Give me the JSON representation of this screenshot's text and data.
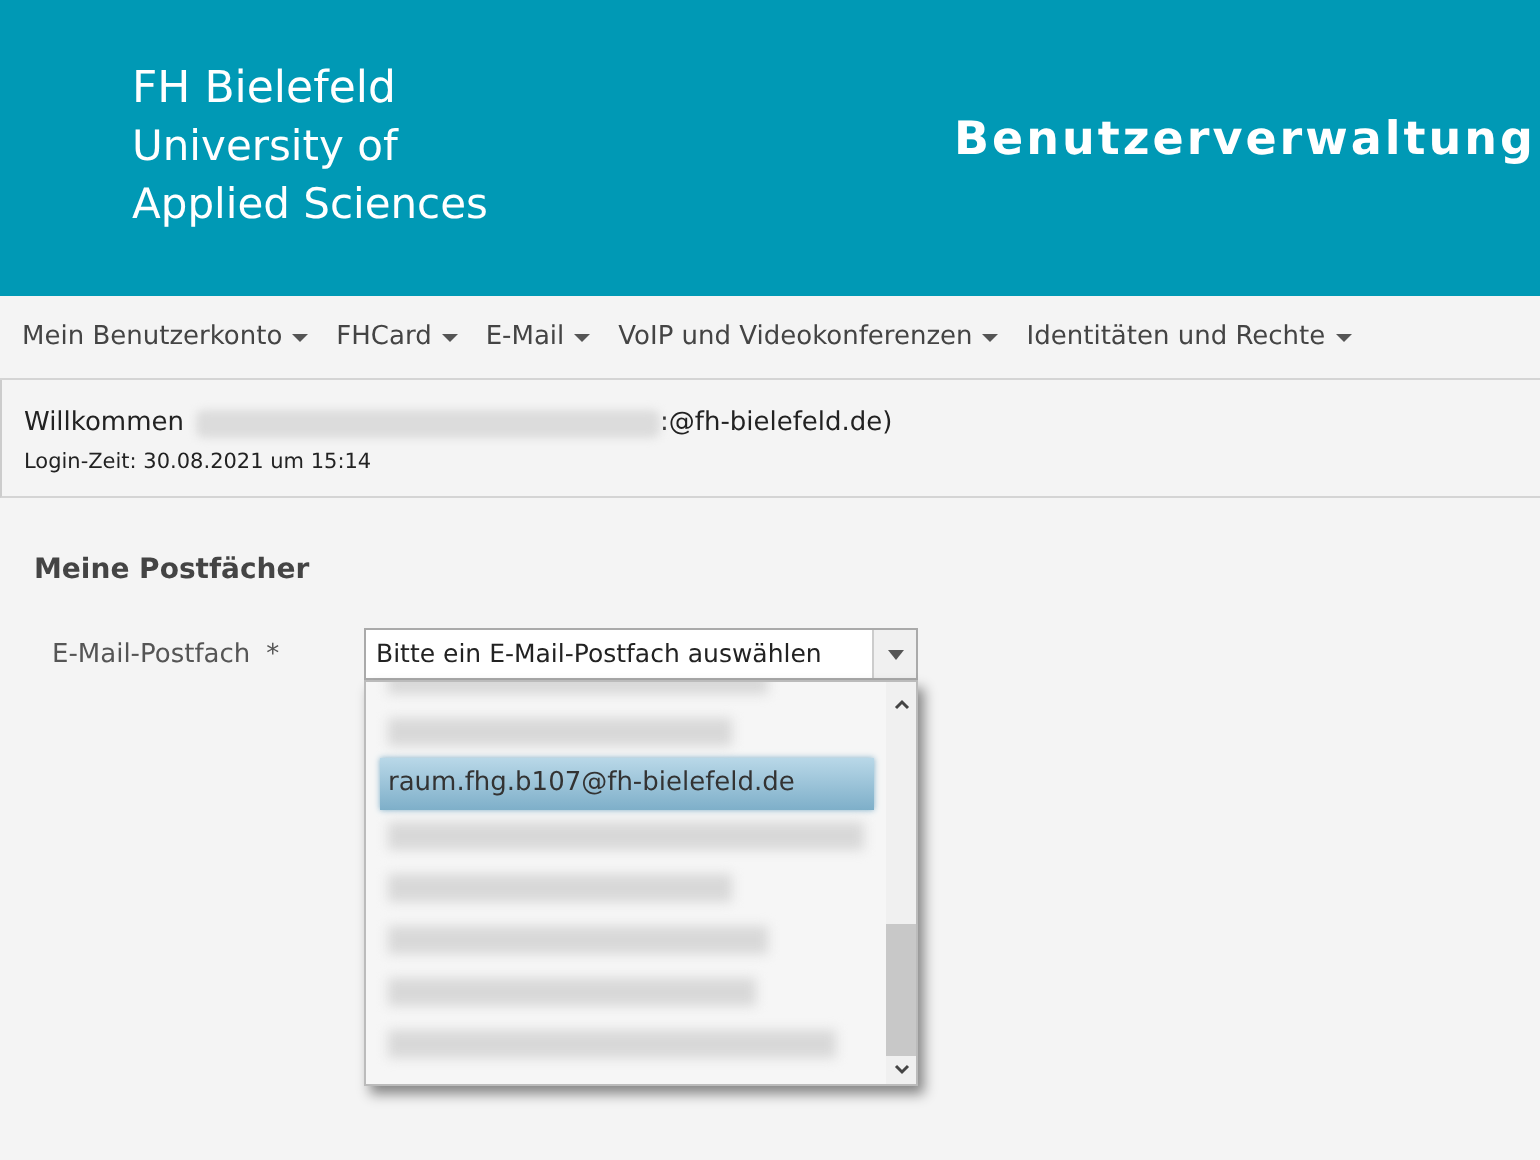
{
  "header": {
    "logo_lines": [
      "FH Bielefeld",
      "University of",
      "Applied Sciences"
    ],
    "title": "Benutzerverwaltung"
  },
  "nav": [
    "Mein Benutzerkonto",
    "FHCard",
    "E-Mail",
    "VoIP und Videokonferenzen",
    "Identitäten und Rechte"
  ],
  "welcome": {
    "prefix": "Willkommen",
    "suffix": ":@fh-bielefeld.de)",
    "login_time": "Login-Zeit: 30.08.2021 um 15:14"
  },
  "section": {
    "title": "Meine Postfächer",
    "field_label": "E-Mail-Postfach",
    "required_mark": "*",
    "select_value": "Bitte ein E-Mail-Postfach auswählen",
    "options": [
      {
        "kind": "redacted",
        "selected": false
      },
      {
        "kind": "redacted",
        "selected": false
      },
      {
        "kind": "text",
        "label": "raum.fhg.b107@fh-bielefeld.de",
        "selected": true
      },
      {
        "kind": "redacted",
        "selected": false
      },
      {
        "kind": "redacted",
        "selected": false
      },
      {
        "kind": "redacted",
        "selected": false
      },
      {
        "kind": "redacted",
        "selected": false
      },
      {
        "kind": "redacted",
        "selected": false
      }
    ]
  }
}
